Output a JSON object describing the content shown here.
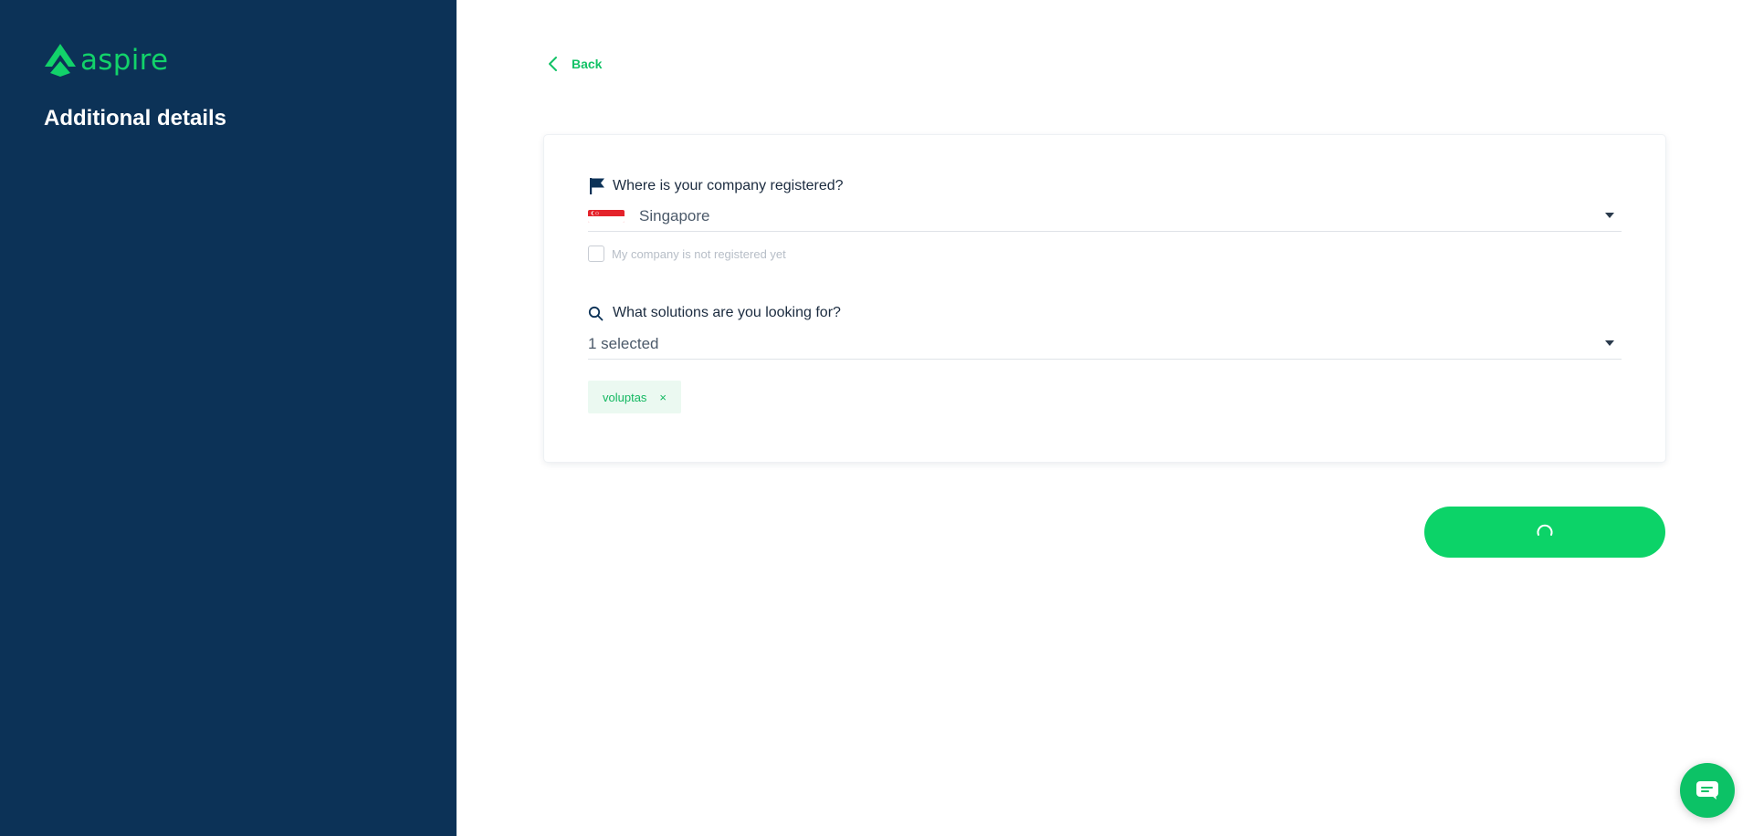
{
  "brand": {
    "name": "aspire",
    "accent_color": "#12d26a",
    "sidebar_color": "#0c3257"
  },
  "sidebar": {
    "title": "Additional details"
  },
  "nav": {
    "back_label": "Back",
    "back_icon": "chevron-left-icon"
  },
  "form": {
    "company_registration": {
      "label": "Where is your company registered?",
      "icon": "flag-icon",
      "selected_country": "Singapore",
      "country_flag": "singapore-flag-icon",
      "not_registered_label": "My company is not registered yet",
      "not_registered_checked": false
    },
    "solutions": {
      "label": "What solutions are you looking for?",
      "icon": "search-icon",
      "selected_summary": "1 selected",
      "selected_tags": [
        {
          "label": "voluptas",
          "remove_symbol": "×"
        }
      ]
    }
  },
  "submit": {
    "state": "loading",
    "icon": "spinner-icon"
  },
  "chat": {
    "icon": "chat-icon"
  }
}
